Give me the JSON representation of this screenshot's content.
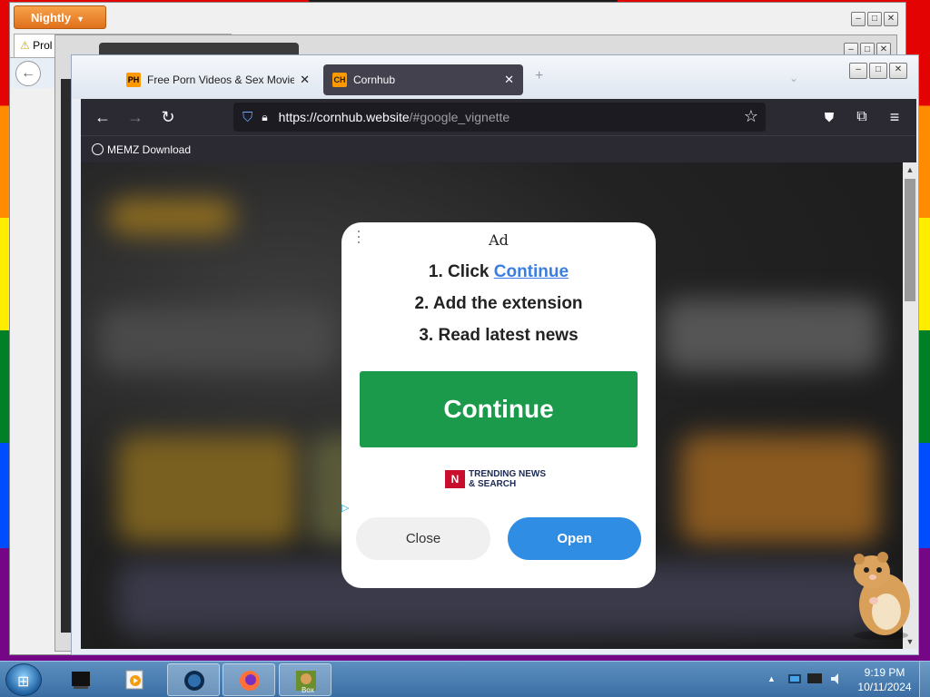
{
  "back_window": {
    "menu_button": "Nightly",
    "tab_label": "Prol",
    "controls": [
      "minimize",
      "maximize",
      "close"
    ]
  },
  "main_window": {
    "tabs": [
      {
        "favicon_text": "PH",
        "label": "Free Porn Videos & Sex Movies",
        "active": false
      },
      {
        "favicon_text": "CH",
        "label": "Cornhub",
        "active": true
      }
    ],
    "url": {
      "host": "https://cornhub.website",
      "path": "/#google_vignette"
    },
    "bookmark": "MEMZ Download",
    "icons": [
      "back-arrow-icon",
      "forward-arrow-icon",
      "reload-icon",
      "shield-icon",
      "lock-icon",
      "star-icon",
      "pocket-icon",
      "extensions-icon",
      "menu-icon"
    ]
  },
  "ad": {
    "label": "Ad",
    "step1_prefix": "1. Click ",
    "step1_link": "Continue",
    "step2": "2.  Add the extension",
    "step3": "3.  Read latest news",
    "continue_label": "Continue",
    "brand_mark": "N",
    "brand_line1": "TRENDING NEWS",
    "brand_line2": "& SEARCH",
    "close_label": "Close",
    "open_label": "Open",
    "colors": {
      "continue": "#1a9a4a",
      "open": "#2f8de4",
      "link": "#3b7de0"
    }
  },
  "taskbar": {
    "items": [
      "device-icon",
      "media-player-icon",
      "globe-icon",
      "firefox-icon",
      "box-game-icon"
    ],
    "box_label": "Box",
    "time": "9:19 PM",
    "date": "10/11/2024"
  }
}
